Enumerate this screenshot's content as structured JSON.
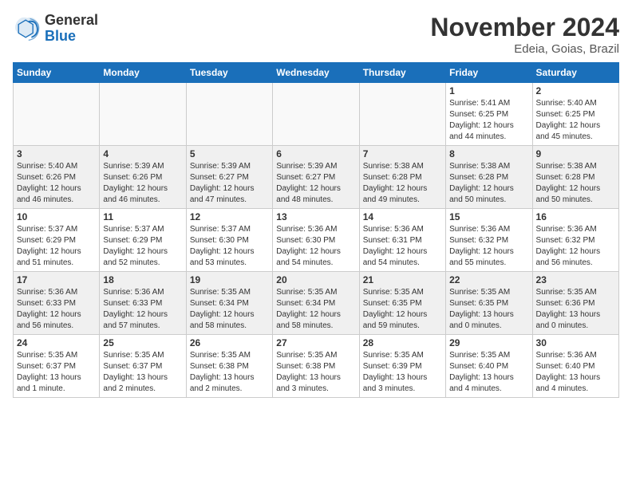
{
  "header": {
    "logo_general": "General",
    "logo_blue": "Blue",
    "month_title": "November 2024",
    "location": "Edeia, Goias, Brazil"
  },
  "weekdays": [
    "Sunday",
    "Monday",
    "Tuesday",
    "Wednesday",
    "Thursday",
    "Friday",
    "Saturday"
  ],
  "weeks": [
    [
      {
        "day": "",
        "info": "",
        "empty": true
      },
      {
        "day": "",
        "info": "",
        "empty": true
      },
      {
        "day": "",
        "info": "",
        "empty": true
      },
      {
        "day": "",
        "info": "",
        "empty": true
      },
      {
        "day": "",
        "info": "",
        "empty": true
      },
      {
        "day": "1",
        "info": "Sunrise: 5:41 AM\nSunset: 6:25 PM\nDaylight: 12 hours\nand 44 minutes."
      },
      {
        "day": "2",
        "info": "Sunrise: 5:40 AM\nSunset: 6:25 PM\nDaylight: 12 hours\nand 45 minutes."
      }
    ],
    [
      {
        "day": "3",
        "info": "Sunrise: 5:40 AM\nSunset: 6:26 PM\nDaylight: 12 hours\nand 46 minutes."
      },
      {
        "day": "4",
        "info": "Sunrise: 5:39 AM\nSunset: 6:26 PM\nDaylight: 12 hours\nand 46 minutes."
      },
      {
        "day": "5",
        "info": "Sunrise: 5:39 AM\nSunset: 6:27 PM\nDaylight: 12 hours\nand 47 minutes."
      },
      {
        "day": "6",
        "info": "Sunrise: 5:39 AM\nSunset: 6:27 PM\nDaylight: 12 hours\nand 48 minutes."
      },
      {
        "day": "7",
        "info": "Sunrise: 5:38 AM\nSunset: 6:28 PM\nDaylight: 12 hours\nand 49 minutes."
      },
      {
        "day": "8",
        "info": "Sunrise: 5:38 AM\nSunset: 6:28 PM\nDaylight: 12 hours\nand 50 minutes."
      },
      {
        "day": "9",
        "info": "Sunrise: 5:38 AM\nSunset: 6:28 PM\nDaylight: 12 hours\nand 50 minutes."
      }
    ],
    [
      {
        "day": "10",
        "info": "Sunrise: 5:37 AM\nSunset: 6:29 PM\nDaylight: 12 hours\nand 51 minutes."
      },
      {
        "day": "11",
        "info": "Sunrise: 5:37 AM\nSunset: 6:29 PM\nDaylight: 12 hours\nand 52 minutes."
      },
      {
        "day": "12",
        "info": "Sunrise: 5:37 AM\nSunset: 6:30 PM\nDaylight: 12 hours\nand 53 minutes."
      },
      {
        "day": "13",
        "info": "Sunrise: 5:36 AM\nSunset: 6:30 PM\nDaylight: 12 hours\nand 54 minutes."
      },
      {
        "day": "14",
        "info": "Sunrise: 5:36 AM\nSunset: 6:31 PM\nDaylight: 12 hours\nand 54 minutes."
      },
      {
        "day": "15",
        "info": "Sunrise: 5:36 AM\nSunset: 6:32 PM\nDaylight: 12 hours\nand 55 minutes."
      },
      {
        "day": "16",
        "info": "Sunrise: 5:36 AM\nSunset: 6:32 PM\nDaylight: 12 hours\nand 56 minutes."
      }
    ],
    [
      {
        "day": "17",
        "info": "Sunrise: 5:36 AM\nSunset: 6:33 PM\nDaylight: 12 hours\nand 56 minutes."
      },
      {
        "day": "18",
        "info": "Sunrise: 5:36 AM\nSunset: 6:33 PM\nDaylight: 12 hours\nand 57 minutes."
      },
      {
        "day": "19",
        "info": "Sunrise: 5:35 AM\nSunset: 6:34 PM\nDaylight: 12 hours\nand 58 minutes."
      },
      {
        "day": "20",
        "info": "Sunrise: 5:35 AM\nSunset: 6:34 PM\nDaylight: 12 hours\nand 58 minutes."
      },
      {
        "day": "21",
        "info": "Sunrise: 5:35 AM\nSunset: 6:35 PM\nDaylight: 12 hours\nand 59 minutes."
      },
      {
        "day": "22",
        "info": "Sunrise: 5:35 AM\nSunset: 6:35 PM\nDaylight: 13 hours\nand 0 minutes."
      },
      {
        "day": "23",
        "info": "Sunrise: 5:35 AM\nSunset: 6:36 PM\nDaylight: 13 hours\nand 0 minutes."
      }
    ],
    [
      {
        "day": "24",
        "info": "Sunrise: 5:35 AM\nSunset: 6:37 PM\nDaylight: 13 hours\nand 1 minute."
      },
      {
        "day": "25",
        "info": "Sunrise: 5:35 AM\nSunset: 6:37 PM\nDaylight: 13 hours\nand 2 minutes."
      },
      {
        "day": "26",
        "info": "Sunrise: 5:35 AM\nSunset: 6:38 PM\nDaylight: 13 hours\nand 2 minutes."
      },
      {
        "day": "27",
        "info": "Sunrise: 5:35 AM\nSunset: 6:38 PM\nDaylight: 13 hours\nand 3 minutes."
      },
      {
        "day": "28",
        "info": "Sunrise: 5:35 AM\nSunset: 6:39 PM\nDaylight: 13 hours\nand 3 minutes."
      },
      {
        "day": "29",
        "info": "Sunrise: 5:35 AM\nSunset: 6:40 PM\nDaylight: 13 hours\nand 4 minutes."
      },
      {
        "day": "30",
        "info": "Sunrise: 5:36 AM\nSunset: 6:40 PM\nDaylight: 13 hours\nand 4 minutes."
      }
    ]
  ]
}
